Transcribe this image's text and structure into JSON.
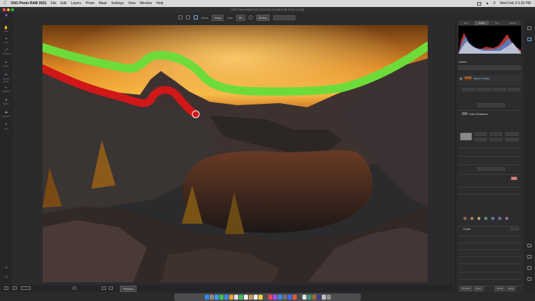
{
  "menubar": {
    "app_name": "ON1 Photo RAW 2021",
    "items": [
      "File",
      "Edit",
      "Layers",
      "Photo",
      "Mask",
      "Settings",
      "View",
      "Window",
      "Help"
    ],
    "clock": "Wed Feb 3  5:36 PM"
  },
  "window": {
    "title": "ON1 Photo RAW 2021 [DSC09176-Edit.tif @ 40.6% 16-bit]"
  },
  "toolbar": {
    "mode_label": "Mode",
    "mode_value": "Keep",
    "size_label": "Size",
    "size_value": "50",
    "refine_label": "Refine"
  },
  "left_tools": [
    "View",
    "Crop",
    "Transform",
    "Brush",
    "Perfect Brush",
    "Masking",
    "Refine",
    "Retouch",
    "Text",
    "Portrait",
    "Local"
  ],
  "statusbar": {
    "preview_label": "Preview"
  },
  "right_panel": {
    "tabs": [
      "Nav",
      "Levels",
      "Info",
      "History"
    ],
    "active_tab": "Levels",
    "layers_heading": "Layers",
    "layer_name": "Winter Peaks",
    "color_enhancer_title": "Color Enhancer",
    "section_heading": "Detail",
    "footer_buttons": [
      "Reset All",
      "Reset",
      "Cancel",
      "Done"
    ]
  },
  "swatch_colors": [
    "#c24a3a",
    "#e08a2f",
    "#e0c836",
    "#4aa84a",
    "#4a8ad6",
    "#8a5ad6",
    "#d65aa8"
  ],
  "stroke_colors": {
    "keep": "#6ddc3a",
    "remove": "#d01818"
  },
  "icons": [
    "apple-icon",
    "wifi-icon",
    "search-icon",
    "brush-icon",
    "eye-icon",
    "histogram-icon"
  ]
}
